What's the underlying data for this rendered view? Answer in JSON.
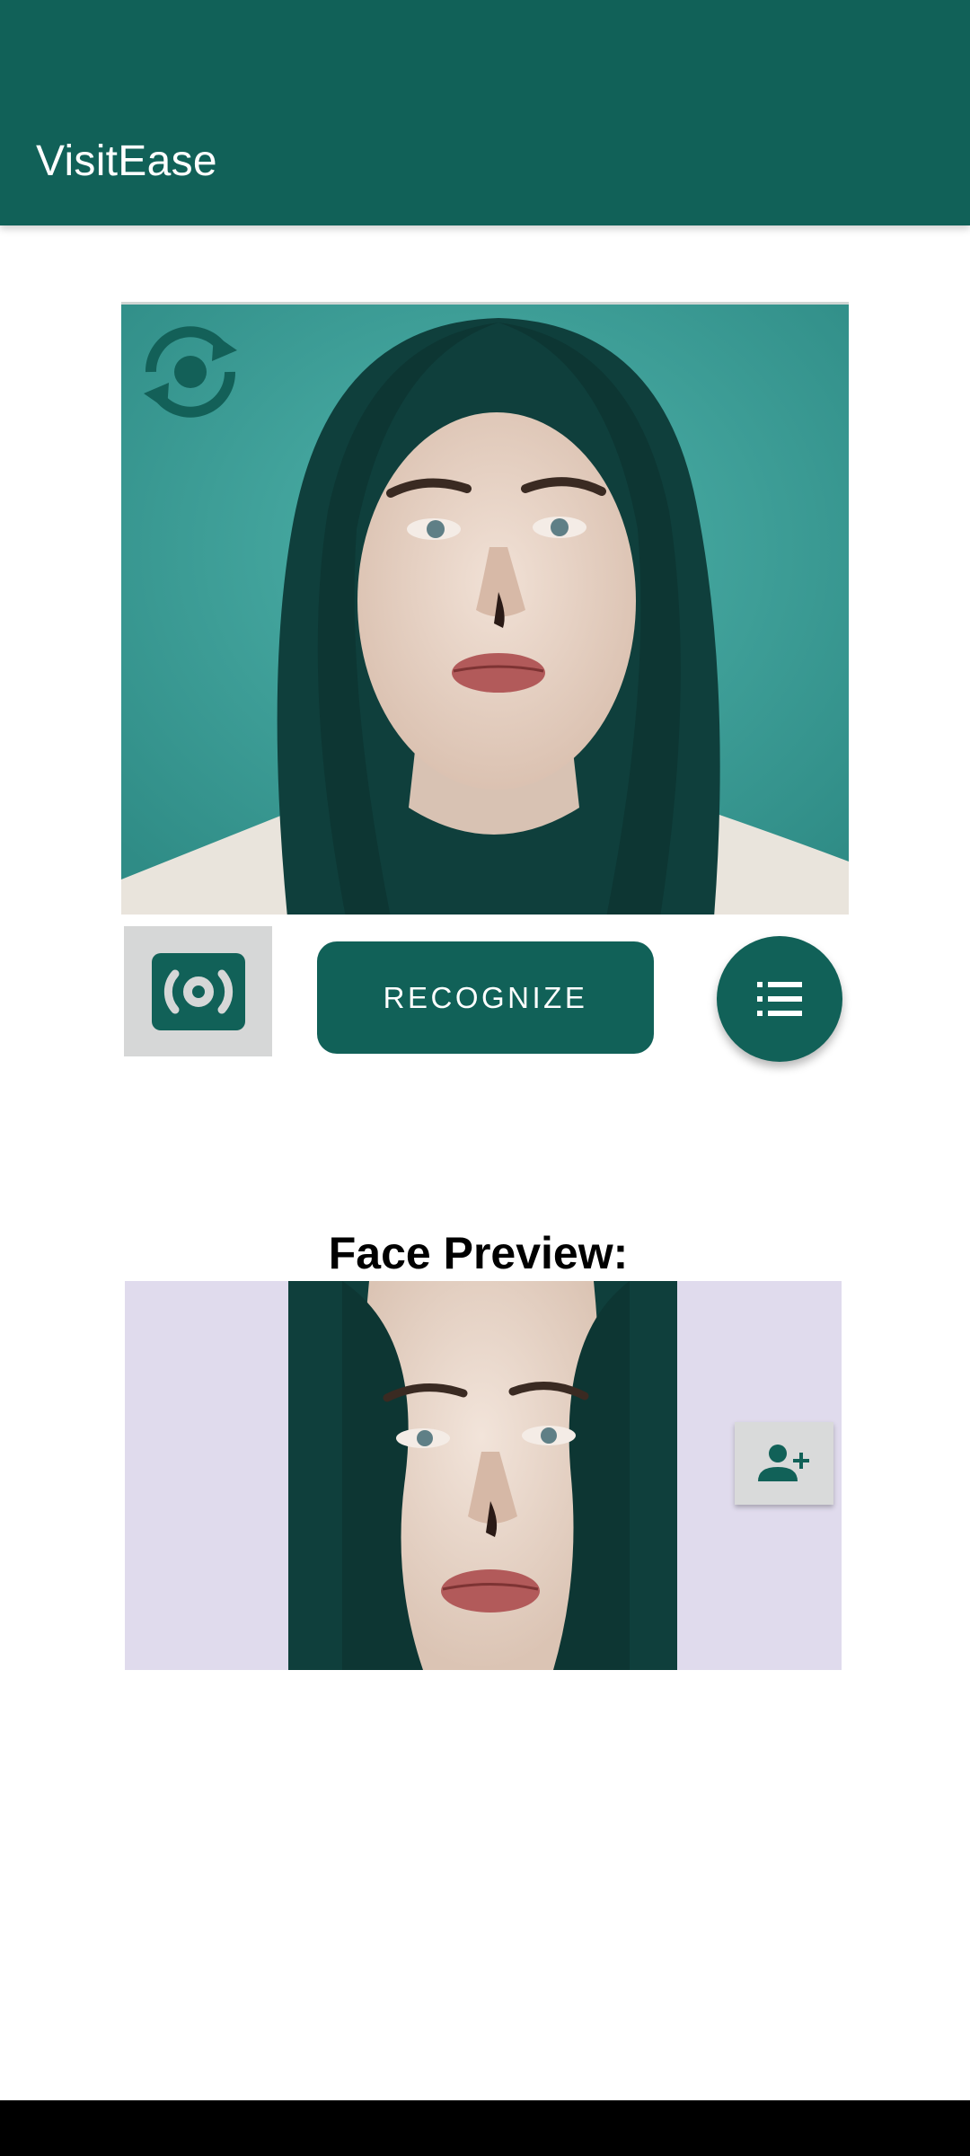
{
  "app_bar": {
    "title": "VisitEase"
  },
  "camera": {
    "switch_icon": "switch-camera-icon",
    "capture_icon": "camera-capture-icon"
  },
  "actions": {
    "recognize_label": "RECOGNIZE",
    "list_icon": "list-icon"
  },
  "preview": {
    "title": "Face Preview:",
    "add_icon": "person-add-icon"
  },
  "colors": {
    "primary": "#116158",
    "preview_background": "#e0dbed",
    "button_grey": "#d6d7d7"
  }
}
